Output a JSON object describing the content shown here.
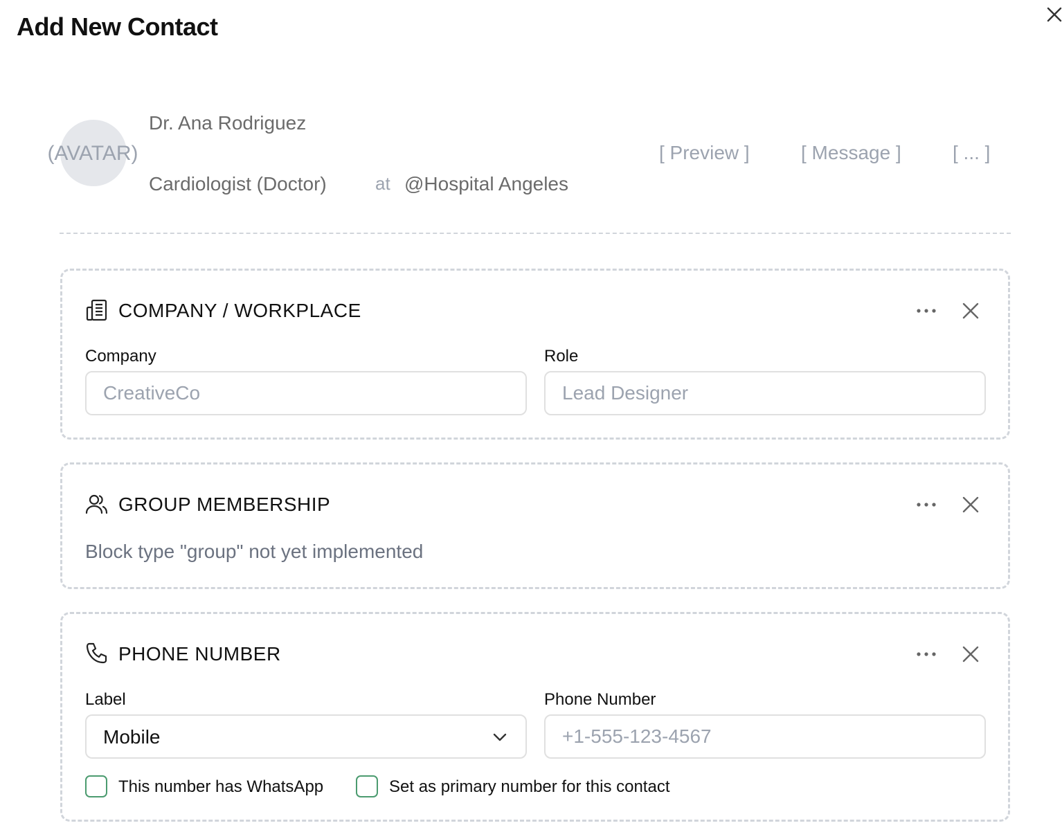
{
  "dialog": {
    "title": "Add New Contact",
    "close_label": "close"
  },
  "contact": {
    "avatar_placeholder": "(AVATAR)",
    "name": "Dr. Ana Rodriguez",
    "role": "Cardiologist (Doctor)",
    "at": "at",
    "organization": "@Hospital Angeles",
    "actions": [
      "[ Preview ]",
      "[ Message ]",
      "[ ... ]"
    ]
  },
  "blocks": {
    "company": {
      "title": "COMPANY / WORKPLACE",
      "icon": "building-icon",
      "company_label": "Company",
      "company_placeholder": "CreativeCo",
      "role_label": "Role",
      "role_placeholder": "Lead Designer"
    },
    "group": {
      "title": "GROUP MEMBERSHIP",
      "icon": "users-icon",
      "note": "Block type \"group\" not yet implemented"
    },
    "phone": {
      "title": "PHONE NUMBER",
      "icon": "phone-icon",
      "label_label": "Label",
      "label_value": "Mobile",
      "number_label": "Phone Number",
      "number_placeholder": "+1-555-123-4567",
      "whatsapp_label": "This number has WhatsApp",
      "whatsapp_checked": false,
      "primary_label": "Set as primary number for this contact",
      "primary_checked": false
    }
  },
  "colors": {
    "checkbox_border": "#4b9b6f",
    "dashed_border": "#d1d5db",
    "muted_text": "#6b6b6b",
    "placeholder_text": "#9ca3af"
  }
}
